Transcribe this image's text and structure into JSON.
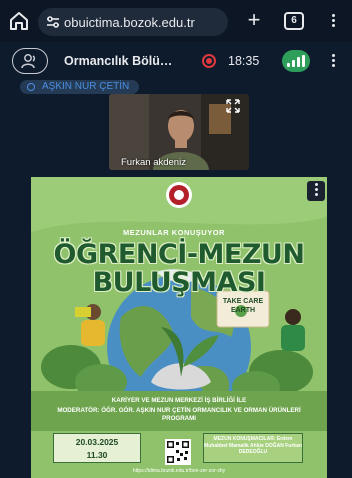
{
  "browser": {
    "url": "obuictima.bozok.edu.tr",
    "tab_count": "6"
  },
  "meeting": {
    "title": "Ormancılık Bölü…",
    "time": "18:35",
    "presenter": "AŞKIN NUR ÇETİN",
    "recording_color": "#e0383e",
    "connection_color": "#2e9e5b"
  },
  "webcam": {
    "participant_name": "Furkan akdeniz"
  },
  "poster": {
    "subtitle": "MEZUNLAR KONUŞUYOR",
    "title_line1": "ÖĞRENCİ-MEZUN",
    "title_line2": "BULUŞMASI",
    "sign_text": "TAKE CARE EARTH",
    "collab_line": "KARİYER VE MEZUN MERKEZİ İŞ BİRLİĞİ İLE",
    "moderator_line": "MODERATÖR: ÖĞR. GÖR. AŞKIN NUR ÇETİN ORMANCILIK VE ORMAN ÜRÜNLERİ PROGRAMI",
    "date": "20.03.2025",
    "time": "11.30",
    "speakers": "MEZUN KONUŞMACILAR: Erdem Muhabbet Mamalik Ahlüe DOĞAN Furkan DEDEOĞLU",
    "link": "https://idima.bozok.edu.tr/bon-zer-zor-xhy",
    "background_color": "#8fc26a",
    "title_color": "#1f5b2e"
  }
}
